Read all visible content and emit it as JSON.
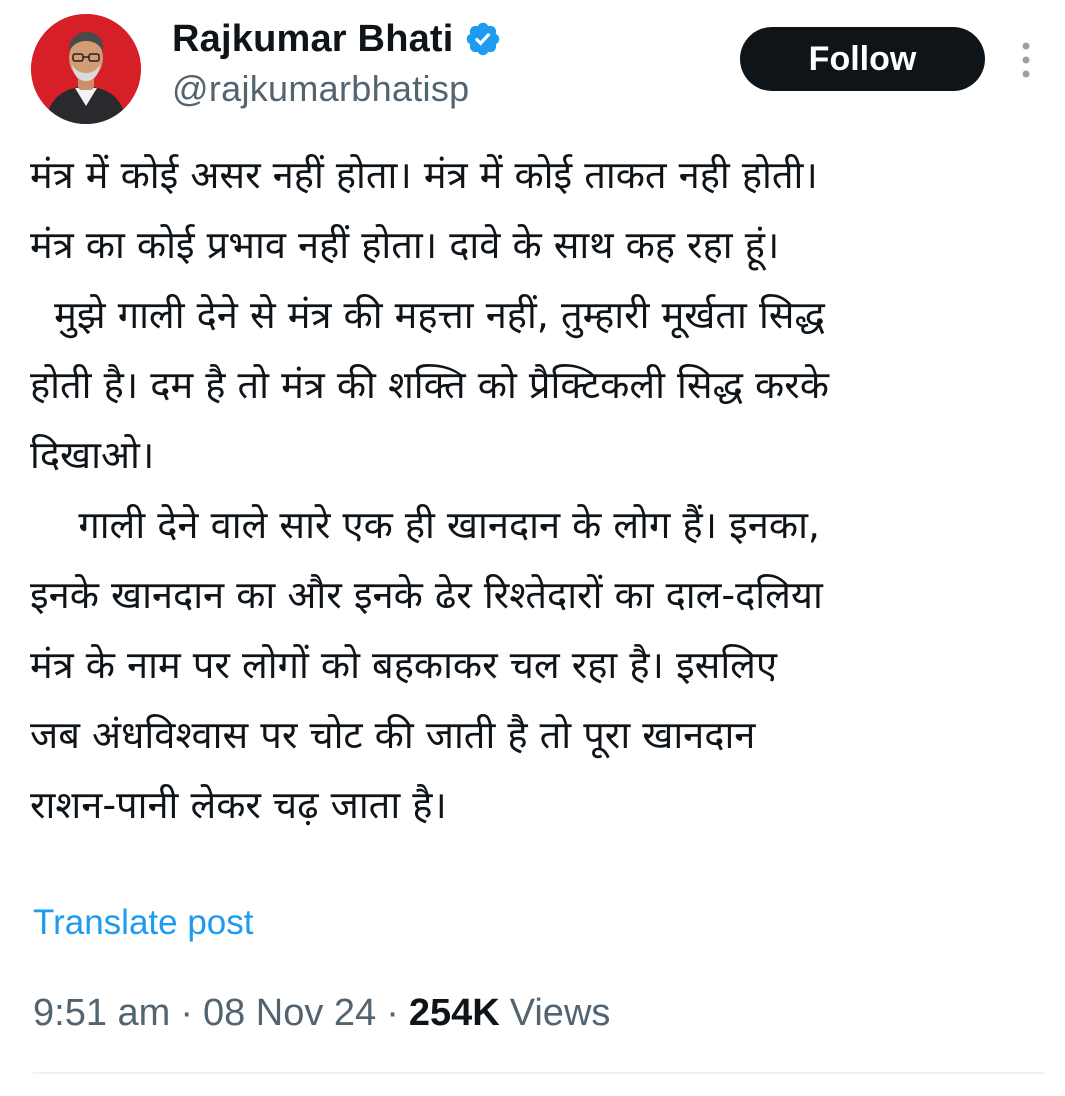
{
  "author": {
    "display_name": "Rajkumar Bhati",
    "handle": "@rajkumarbhatisp",
    "verified": true,
    "avatar_icon": "profile-photo",
    "avatar_bg": "#d61f26"
  },
  "actions": {
    "follow_label": "Follow",
    "more_icon": "more-vertical-icon"
  },
  "post": {
    "lines": [
      "मंत्र में कोई असर नहीं होता। मंत्र में कोई ताकत नही होती।",
      "मंत्र का कोई प्रभाव नहीं होता। दावे के साथ कह रहा हूं।",
      "  मुझे गाली देने से मंत्र की महत्ता नहीं, तुम्हारी मूर्खता सिद्ध",
      "होती है। दम है तो मंत्र की शक्ति को प्रैक्टिकली सिद्ध करके",
      "दिखाओ।",
      "    गाली देने वाले सारे एक ही खानदान के लोग हैं। इनका,",
      "इनके खानदान का और इनके ढेर रिश्तेदारों का दाल-दलिया",
      "मंत्र के नाम पर लोगों को बहकाकर चल रहा है। इसलिए",
      "जब अंधविश्वास पर चोट की जाती है तो पूरा खानदान",
      "राशन-पानी लेकर चढ़ जाता है।"
    ],
    "translate_label": "Translate post"
  },
  "meta": {
    "time": "9:51 am",
    "separator": "·",
    "date": "08 Nov 24",
    "views_count": "254K",
    "views_label": "Views"
  },
  "colors": {
    "text": "#0f1419",
    "secondary": "#536471",
    "link": "#1d9bf0",
    "verified": "#1d9bf0",
    "button_bg": "#0f1419"
  }
}
